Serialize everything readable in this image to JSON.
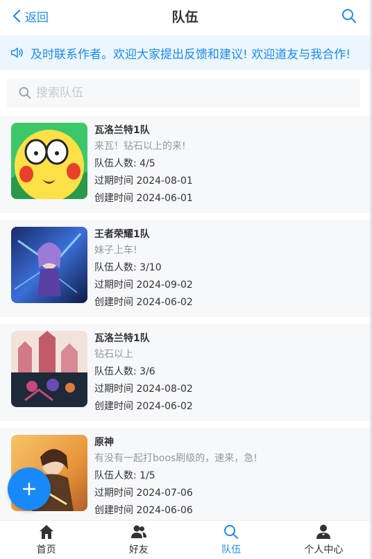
{
  "navbar": {
    "back_label": "返回",
    "title": "队伍"
  },
  "notice": {
    "text": "及时联系作者。欢迎大家提出反馈和建议! 欢迎道友与我合作!"
  },
  "search": {
    "placeholder": "搜索队伍",
    "value": ""
  },
  "teams": [
    {
      "name": "瓦洛兰特1队",
      "description": "来瓦！钻石以上的来!",
      "members": "队伍人数: 4/5",
      "expire": "过期时间 2024-08-01",
      "created": "创建时间 2024-06-01"
    },
    {
      "name": "王者荣耀1队",
      "description": "妹子上车!",
      "members": "队伍人数: 3/10",
      "expire": "过期时间 2024-09-02",
      "created": "创建时间 2024-06-02"
    },
    {
      "name": "瓦洛兰特1队",
      "description": "钻石以上",
      "members": "队伍人数: 3/6",
      "expire": "过期时间 2024-08-02",
      "created": "创建时间 2024-06-02"
    },
    {
      "name": "原神",
      "description": "有没有一起打boos刷级的，速来，急!",
      "members": "队伍人数: 1/5",
      "expire": "过期时间 2024-07-06",
      "created": "创建时间 2024-06-06"
    }
  ],
  "tabbar": {
    "items": [
      {
        "label": "首页",
        "icon": "home-icon"
      },
      {
        "label": "好友",
        "icon": "friends-icon"
      },
      {
        "label": "队伍",
        "icon": "search-icon"
      },
      {
        "label": "个人中心",
        "icon": "user-icon"
      }
    ],
    "active_index": 2
  },
  "colors": {
    "accent": "#1989fa",
    "notice_bg": "#ecf6fe",
    "card_bg": "#f7f8fa"
  }
}
